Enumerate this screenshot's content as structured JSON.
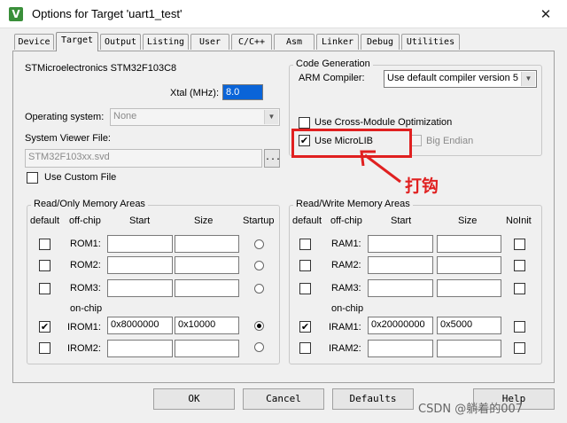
{
  "window": {
    "title": "Options for Target 'uart1_test'",
    "icon_letter": "V",
    "close_symbol": "✕"
  },
  "tabs": [
    {
      "label": "Device"
    },
    {
      "label": "Target"
    },
    {
      "label": "Output"
    },
    {
      "label": "Listing"
    },
    {
      "label": "User"
    },
    {
      "label": "C/C++"
    },
    {
      "label": "Asm"
    },
    {
      "label": "Linker"
    },
    {
      "label": "Debug"
    },
    {
      "label": "Utilities"
    }
  ],
  "target": {
    "device_name": "STMicroelectronics STM32F103C8",
    "xtal_label": "Xtal (MHz):",
    "xtal_value": "8.0",
    "os_label": "Operating system:",
    "os_value": "None",
    "svd_label": "System Viewer File:",
    "svd_value": "STM32F103xx.svd",
    "browse_label": "...",
    "custom_file_label": "Use Custom File"
  },
  "codegen": {
    "title": "Code Generation",
    "compiler_label": "ARM Compiler:",
    "compiler_value": "Use default compiler version 5",
    "cross_module_label": "Use Cross-Module Optimization",
    "microlib_label": "Use MicroLIB",
    "microlib_checked": "✔",
    "big_endian_label": "Big Endian"
  },
  "rom_group": {
    "title": "Read/Only Memory Areas",
    "headers": {
      "default": "default",
      "offchip": "off-chip",
      "start": "Start",
      "size": "Size",
      "startup": "Startup"
    },
    "onchip_label": "on-chip",
    "rows": [
      {
        "label": "ROM1:",
        "start": "",
        "size": "",
        "default": "",
        "startup": false
      },
      {
        "label": "ROM2:",
        "start": "",
        "size": "",
        "default": "",
        "startup": false
      },
      {
        "label": "ROM3:",
        "start": "",
        "size": "",
        "default": "",
        "startup": false
      },
      {
        "label": "IROM1:",
        "start": "0x8000000",
        "size": "0x10000",
        "default": "✔",
        "startup": true
      },
      {
        "label": "IROM2:",
        "start": "",
        "size": "",
        "default": "",
        "startup": false
      }
    ]
  },
  "ram_group": {
    "title": "Read/Write Memory Areas",
    "headers": {
      "default": "default",
      "offchip": "off-chip",
      "start": "Start",
      "size": "Size",
      "noinit": "NoInit"
    },
    "onchip_label": "on-chip",
    "rows": [
      {
        "label": "RAM1:",
        "start": "",
        "size": "",
        "default": ""
      },
      {
        "label": "RAM2:",
        "start": "",
        "size": "",
        "default": ""
      },
      {
        "label": "RAM3:",
        "start": "",
        "size": "",
        "default": ""
      },
      {
        "label": "IRAM1:",
        "start": "0x20000000",
        "size": "0x5000",
        "default": "✔"
      },
      {
        "label": "IRAM2:",
        "start": "",
        "size": "",
        "default": ""
      }
    ]
  },
  "buttons": {
    "ok": "OK",
    "cancel": "Cancel",
    "defaults": "Defaults",
    "help": "Help"
  },
  "annotation": {
    "text": "打钩",
    "color": "#e02020"
  },
  "watermark": "CSDN @躺着的007",
  "colors": {
    "accent": "#0a64d8",
    "annotation": "#e02020"
  }
}
